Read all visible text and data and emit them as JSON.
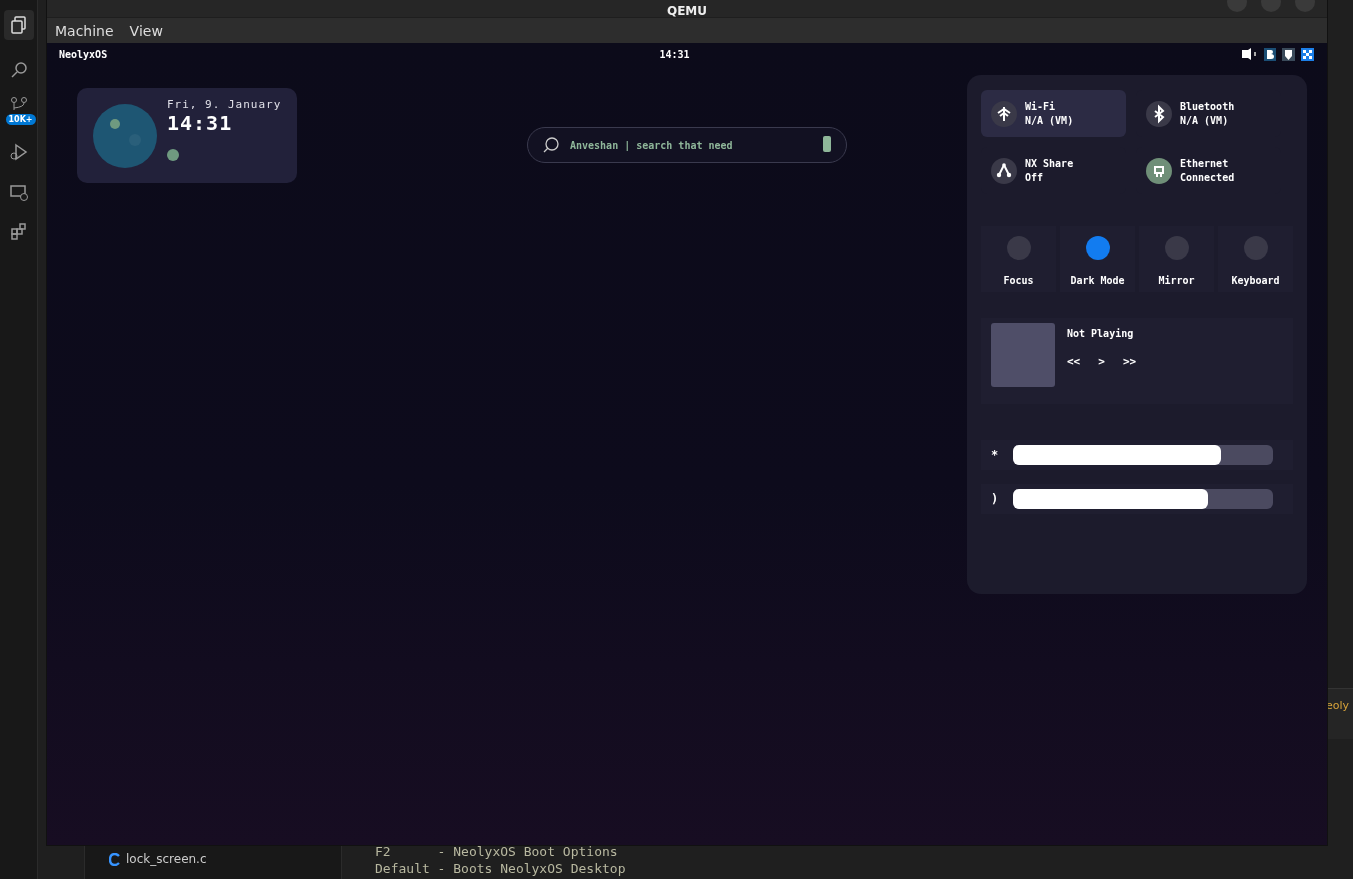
{
  "editor": {
    "badge": "10K+",
    "file_item": "lock_screen.c",
    "terminal_lines": [
      "F2      - NeolyxOS Boot Options",
      "Default - Boots NeolyxOS Desktop"
    ],
    "edge_text": "eoly"
  },
  "window": {
    "title": "QEMU"
  },
  "menu": [
    "Machine",
    "View"
  ],
  "top_bar": {
    "brand": "NeolyxOS",
    "clock": "14:31"
  },
  "clock_widget": {
    "date": "Fri, 9. January",
    "time": "14:31"
  },
  "search": {
    "placeholder": "Anveshan | search that need"
  },
  "control_center": {
    "connections": [
      {
        "kind": "wifi",
        "title": "Wi-Fi",
        "status": "N/A (VM)",
        "on": false,
        "selected": true
      },
      {
        "kind": "bluetooth",
        "title": "Bluetooth",
        "status": "N/A (VM)",
        "on": false,
        "selected": false
      },
      {
        "kind": "share",
        "title": "NX Share",
        "status": "Off",
        "on": false,
        "selected": false
      },
      {
        "kind": "ethernet",
        "title": "Ethernet",
        "status": "Connected",
        "on": true,
        "selected": false
      }
    ],
    "toggles": [
      {
        "label": "Focus",
        "on": false
      },
      {
        "label": "Dark Mode",
        "on": true
      },
      {
        "label": "Mirror",
        "on": false
      },
      {
        "label": "Keyboard",
        "on": false
      }
    ],
    "media": {
      "title": "Not Playing",
      "controls": [
        "<<",
        ">",
        ">>"
      ]
    },
    "sliders": [
      {
        "icon": "*",
        "level": 0.8
      },
      {
        "icon": ")",
        "level": 0.75
      }
    ]
  }
}
